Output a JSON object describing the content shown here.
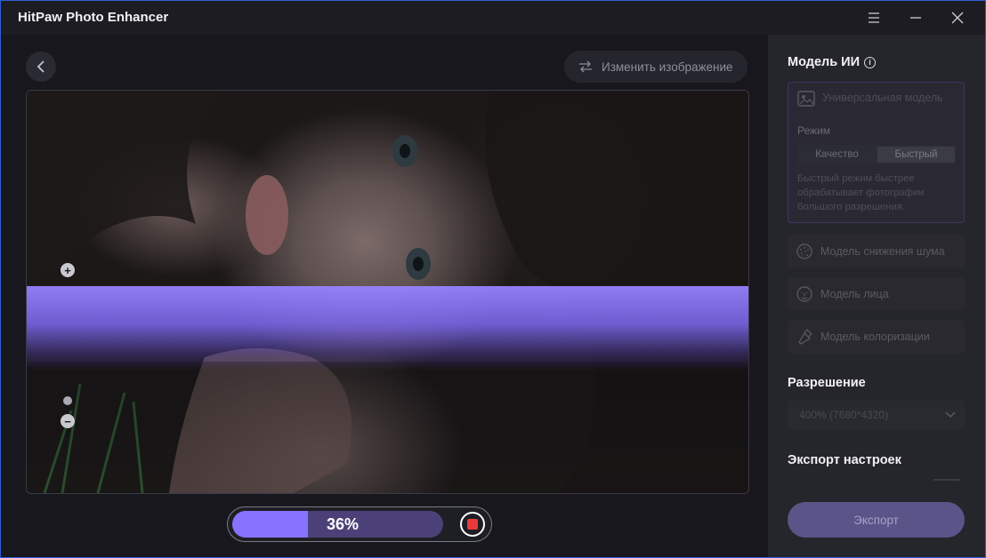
{
  "app": {
    "title": "HitPaw Photo Enhancer"
  },
  "toolbar": {
    "change_image_label": "Изменить изображение"
  },
  "progress": {
    "percent": 36,
    "label": "36%"
  },
  "panel": {
    "ai_model_title": "Модель ИИ",
    "general_model_label": "Универсальная модель",
    "mode_label": "Режим",
    "mode_options": [
      "Качество",
      "Быстрый"
    ],
    "mode_selected": "Быстрый",
    "mode_description": "Быстрый режим быстрее обрабатывает фотографии большого разрешения.",
    "models": [
      {
        "label": "Модель снижения шума",
        "icon": "denoise-icon"
      },
      {
        "label": "Модель лица",
        "icon": "face-icon"
      },
      {
        "label": "Модель колоризации",
        "icon": "colorize-icon"
      }
    ],
    "resolution_title": "Разрешение",
    "resolution_value": "400% (7680*4320)",
    "export_settings_title": "Экспорт настроек",
    "export_button_label": "Экспорт"
  },
  "colors": {
    "accent": "#8673ff",
    "progress_track": "#4b4178",
    "export_button": "#5b5488",
    "stop": "#e93b3b"
  }
}
